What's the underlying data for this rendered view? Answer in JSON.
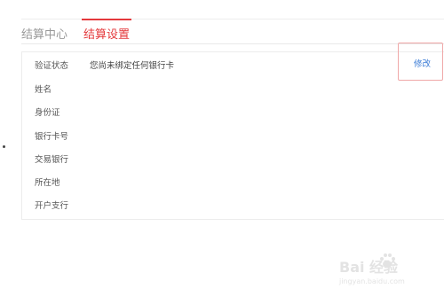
{
  "tabs": {
    "settlement_center": "结算中心",
    "settlement_settings": "结算设置"
  },
  "fields": [
    {
      "label": "验证状态",
      "value": "您尚未绑定任何银行卡"
    },
    {
      "label": "姓名",
      "value": ""
    },
    {
      "label": "身份证",
      "value": ""
    },
    {
      "label": "银行卡号",
      "value": ""
    },
    {
      "label": "交易银行",
      "value": ""
    },
    {
      "label": "所在地",
      "value": ""
    },
    {
      "label": "开户支行",
      "value": ""
    }
  ],
  "edit_label": "修改",
  "watermark": {
    "brand": "Bai  经验",
    "url": "jingyan.baidu.com"
  },
  "colors": {
    "accent": "#e4393c",
    "link": "#3a7bd5",
    "highlight_box": "#f0a8a8"
  }
}
